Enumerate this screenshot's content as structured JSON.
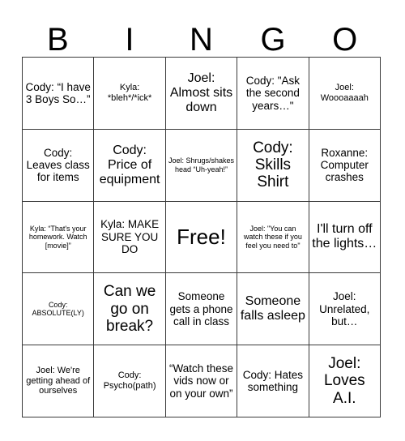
{
  "card": {
    "header_letters": [
      "B",
      "I",
      "N",
      "G",
      "O"
    ],
    "colors": {
      "background": "#ffffff",
      "grid_line": "#3a3a3a",
      "text": "#000000"
    },
    "rows": [
      [
        {
          "text": "Cody: “I have 3 Boys So…”",
          "size": "m"
        },
        {
          "text": "Kyla: *bleh*/*ick*",
          "size": "s"
        },
        {
          "text": "Joel: Almost sits down",
          "size": "l"
        },
        {
          "text": "Cody: \"Ask the second years…\"",
          "size": "m"
        },
        {
          "text": "Joel: Woooaaaah",
          "size": "s"
        }
      ],
      [
        {
          "text": "Cody: Leaves class for items",
          "size": "m"
        },
        {
          "text": "Cody: Price of equipment",
          "size": "l"
        },
        {
          "text": "Joel: Shrugs/shakes head “Uh-yeah!”",
          "size": "xs"
        },
        {
          "text": "Cody: Skills Shirt",
          "size": "xl"
        },
        {
          "text": "Roxanne: Computer crashes",
          "size": "m"
        }
      ],
      [
        {
          "text": "Kyla: “That's your homework. Watch [movie]”",
          "size": "xs"
        },
        {
          "text": "Kyla: MAKE SURE YOU DO",
          "size": "m"
        },
        {
          "text": "Free!",
          "size": "free"
        },
        {
          "text": "Joel: \"You can watch these if you feel you need to\"",
          "size": "xs"
        },
        {
          "text": "I'll turn off the lights…",
          "size": "l"
        }
      ],
      [
        {
          "text": "Cody: ABSOLUTE(LY)",
          "size": "xs"
        },
        {
          "text": "Can we go on break?",
          "size": "xl"
        },
        {
          "text": "Someone gets a phone call in class",
          "size": "m"
        },
        {
          "text": "Someone falls asleep",
          "size": "l"
        },
        {
          "text": "Joel: Unrelated, but…",
          "size": "m"
        }
      ],
      [
        {
          "text": "Joel: We're getting ahead of ourselves",
          "size": "s"
        },
        {
          "text": "Cody: Psycho(path)",
          "size": "s"
        },
        {
          "text": "“Watch these vids now or on your own”",
          "size": "m"
        },
        {
          "text": "Cody: Hates something",
          "size": "m"
        },
        {
          "text": "Joel: Loves A.I.",
          "size": "xl"
        }
      ]
    ]
  }
}
